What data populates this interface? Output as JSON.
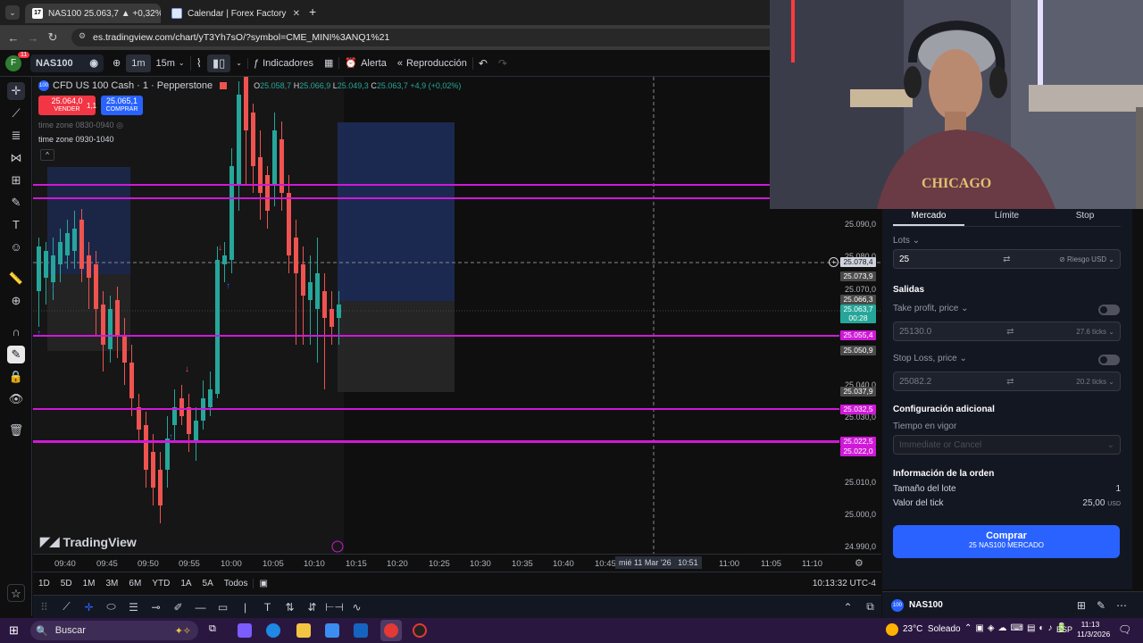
{
  "browser": {
    "tabs": [
      {
        "label": "NAS100 25.063,7 ▲ +0,32% fa",
        "active": true
      },
      {
        "label": "Calendar | Forex Factory",
        "active": false
      }
    ],
    "url": "es.tradingview.com/chart/yT3Yh7sO/?symbol=CME_MINI%3ANQ1%21"
  },
  "toolbar": {
    "profile_badge": "11",
    "profile_letter": "F",
    "symbol": "NAS100",
    "interval_1": "1m",
    "interval_2": "15m",
    "indicators": "Indicadores",
    "alert": "Alerta",
    "replay": "Reproducción"
  },
  "chart": {
    "title": "CFD US 100 Cash · 1 · Pepperstone",
    "ohlc": {
      "o": "25.058,7",
      "h": "25.066,9",
      "l": "25.049,3",
      "c": "25.063,7",
      "change": "+4,9 (+0,02%)"
    },
    "sell_price": "25.064,0",
    "sell_label": "VENDER",
    "buy_price": "25.065,1",
    "buy_label": "COMPRAR",
    "spread": "1,1",
    "tz1": "time zone 0830-0940",
    "tz2": "time zone 0930-1040",
    "watermark": "TradingView",
    "price_labels": [
      "25.090,0",
      "25.080,0",
      "25.070,0",
      "25.040,0",
      "25.030,0",
      "25.010,0",
      "25.000,0",
      "24.990,0"
    ],
    "price_tags": [
      {
        "value": "25.078,4",
        "color": "#d1d4dc"
      },
      {
        "value": "25.073,9",
        "color": "#4a4a4a"
      },
      {
        "value": "25.066,3",
        "color": "#4a4a4a"
      },
      {
        "value": "25.063,7",
        "color": "#26a69a"
      },
      {
        "value": "00:28",
        "color": "#26a69a"
      },
      {
        "value": "25.055,4",
        "color": "#d018d8"
      },
      {
        "value": "25.050,9",
        "color": "#4a4a4a"
      },
      {
        "value": "25.037,9",
        "color": "#4a4a4a"
      },
      {
        "value": "25.032,5",
        "color": "#d018d8"
      },
      {
        "value": "25.022,5",
        "color": "#d018d8"
      },
      {
        "value": "25.022,0",
        "color": "#d018d8"
      }
    ],
    "time_labels": [
      "09:40",
      "09:45",
      "09:50",
      "09:55",
      "10:00",
      "10:05",
      "10:10",
      "10:15",
      "10:20",
      "10:25",
      "10:30",
      "10:35",
      "10:40",
      "10:45",
      "11:00",
      "11:05",
      "11:10"
    ],
    "crosshair_time": "mié 11 Mar '26   10:51",
    "ranges": [
      "1D",
      "5D",
      "1M",
      "3M",
      "6M",
      "YTD",
      "1A",
      "5A",
      "Todos"
    ],
    "clock": "10:13:32 UTC-4"
  },
  "order_panel": {
    "tabs": [
      "Mercado",
      "Límite",
      "Stop"
    ],
    "lots_label": "Lots",
    "lots_value": "25",
    "risk": "Riesgo USD",
    "exits_title": "Salidas",
    "tp_label": "Take profit, price",
    "tp_value": "25130.0",
    "tp_ticks": "27.6 ticks",
    "sl_label": "Stop Loss, price",
    "sl_value": "25082.2",
    "sl_ticks": "20.2 ticks",
    "config_title": "Configuración adicional",
    "tif_label": "Tiempo en vigor",
    "tif_value": "Immediate or Cancel",
    "info_title": "Información de la orden",
    "lot_size_label": "Tamaño del lote",
    "lot_size_value": "1",
    "tick_value_label": "Valor del tick",
    "tick_value_value": "25,00",
    "tick_value_unit": "USD",
    "buy_button": "Comprar",
    "buy_sub": "25 NAS100 MERCADO",
    "symbol": "NAS100"
  },
  "taskbar": {
    "search": "Buscar",
    "weather": "23°C  Soleado",
    "lang": "ESP",
    "time": "11:13",
    "date": "11/3/2026"
  },
  "colors": {
    "bull": "#26a69a",
    "bear": "#ef5350",
    "level": "#d018d8",
    "accent": "#2962ff"
  }
}
